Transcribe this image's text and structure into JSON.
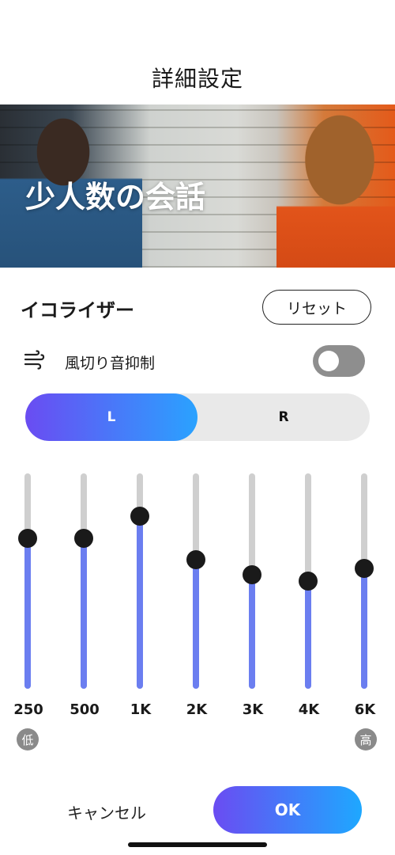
{
  "header": {
    "title": "詳細設定"
  },
  "hero": {
    "caption": "少人数の会話",
    "image": "two-people-talking-photo"
  },
  "equalizer": {
    "label": "イコライザー",
    "reset_label": "リセット",
    "wind": {
      "label": "風切り音抑制",
      "icon": "wind-icon",
      "enabled": false
    },
    "channels": {
      "left": "L",
      "right": "R",
      "selected": "L"
    },
    "bands": [
      {
        "freq": "250",
        "level": 0.7
      },
      {
        "freq": "500",
        "level": 0.7
      },
      {
        "freq": "1K",
        "level": 0.8
      },
      {
        "freq": "2K",
        "level": 0.6
      },
      {
        "freq": "3K",
        "level": 0.53
      },
      {
        "freq": "4K",
        "level": 0.5
      },
      {
        "freq": "6K",
        "level": 0.56
      }
    ],
    "low_tag": "低",
    "high_tag": "高"
  },
  "footer": {
    "cancel_label": "キャンセル",
    "ok_label": "OK"
  },
  "colors": {
    "accent_start": "#6a4cf2",
    "accent_end": "#1ea8ff",
    "slider_fill": "#6b7ef0",
    "toggle_off": "#8e8e8e"
  }
}
